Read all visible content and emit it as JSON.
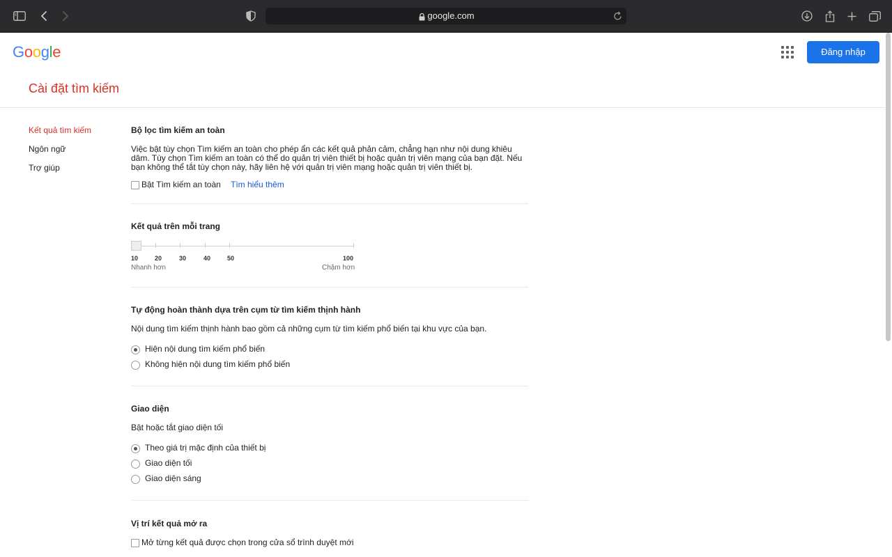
{
  "browser": {
    "url": "google.com"
  },
  "header": {
    "logo_letters": [
      "G",
      "o",
      "o",
      "g",
      "l",
      "e"
    ],
    "signin_label": "Đăng nhập"
  },
  "page_title": "Cài đặt tìm kiếm",
  "sidebar": {
    "items": [
      {
        "label": "Kết quả tìm kiếm",
        "active": true
      },
      {
        "label": "Ngôn ngữ",
        "active": false
      },
      {
        "label": "Trợ giúp",
        "active": false
      }
    ]
  },
  "safesearch": {
    "title": "Bộ lọc tìm kiếm an toàn",
    "desc_line1": "Việc bật tùy chọn Tìm kiếm an toàn cho phép ẩn các kết quả phản cảm, chẳng hạn như nội dung khiêu",
    "desc_line2": "dâm. Tùy chọn Tìm kiếm an toàn có thể do quản trị viên thiết bị hoặc quản trị viên mạng của bạn đặt. Nếu",
    "desc_line3": "bạn không thể tắt tùy chọn này, hãy liên hệ với quản trị viên mạng hoặc quản trị viên thiết bị.",
    "checkbox_label": "Bật Tìm kiếm an toàn",
    "checked": false,
    "learn_more": "Tìm hiểu thêm"
  },
  "results_per_page": {
    "title": "Kết quả trên mỗi trang",
    "ticks": [
      "10",
      "20",
      "30",
      "40",
      "50",
      "100"
    ],
    "value": 10,
    "faster_label": "Nhanh hơn",
    "slower_label": "Chậm hơn"
  },
  "autocomplete": {
    "title": "Tự động hoàn thành dựa trên cụm từ tìm kiếm thịnh hành",
    "desc": "Nội dung tìm kiếm thịnh hành bao gồm cả những cụm từ tìm kiếm phổ biến tại khu vực của bạn.",
    "options": [
      {
        "label": "Hiện nội dung tìm kiếm phổ biến",
        "checked": true
      },
      {
        "label": "Không hiện nội dung tìm kiếm phổ biến",
        "checked": false
      }
    ]
  },
  "appearance": {
    "title": "Giao diện",
    "desc": "Bật hoặc tắt giao diện tối",
    "options": [
      {
        "label": "Theo giá trị mặc định của thiết bị",
        "checked": true
      },
      {
        "label": "Giao diện tối",
        "checked": false
      },
      {
        "label": "Giao diện sáng",
        "checked": false
      }
    ]
  },
  "results_window": {
    "title": "Vị trí kết quả mở ra",
    "checkbox_label": "Mở từng kết quả được chọn trong cửa sổ trình duyệt mới",
    "checked": false
  },
  "colors": {
    "accent_red": "#d93025",
    "link_blue": "#1558d6",
    "button_blue": "#1a73e8"
  }
}
